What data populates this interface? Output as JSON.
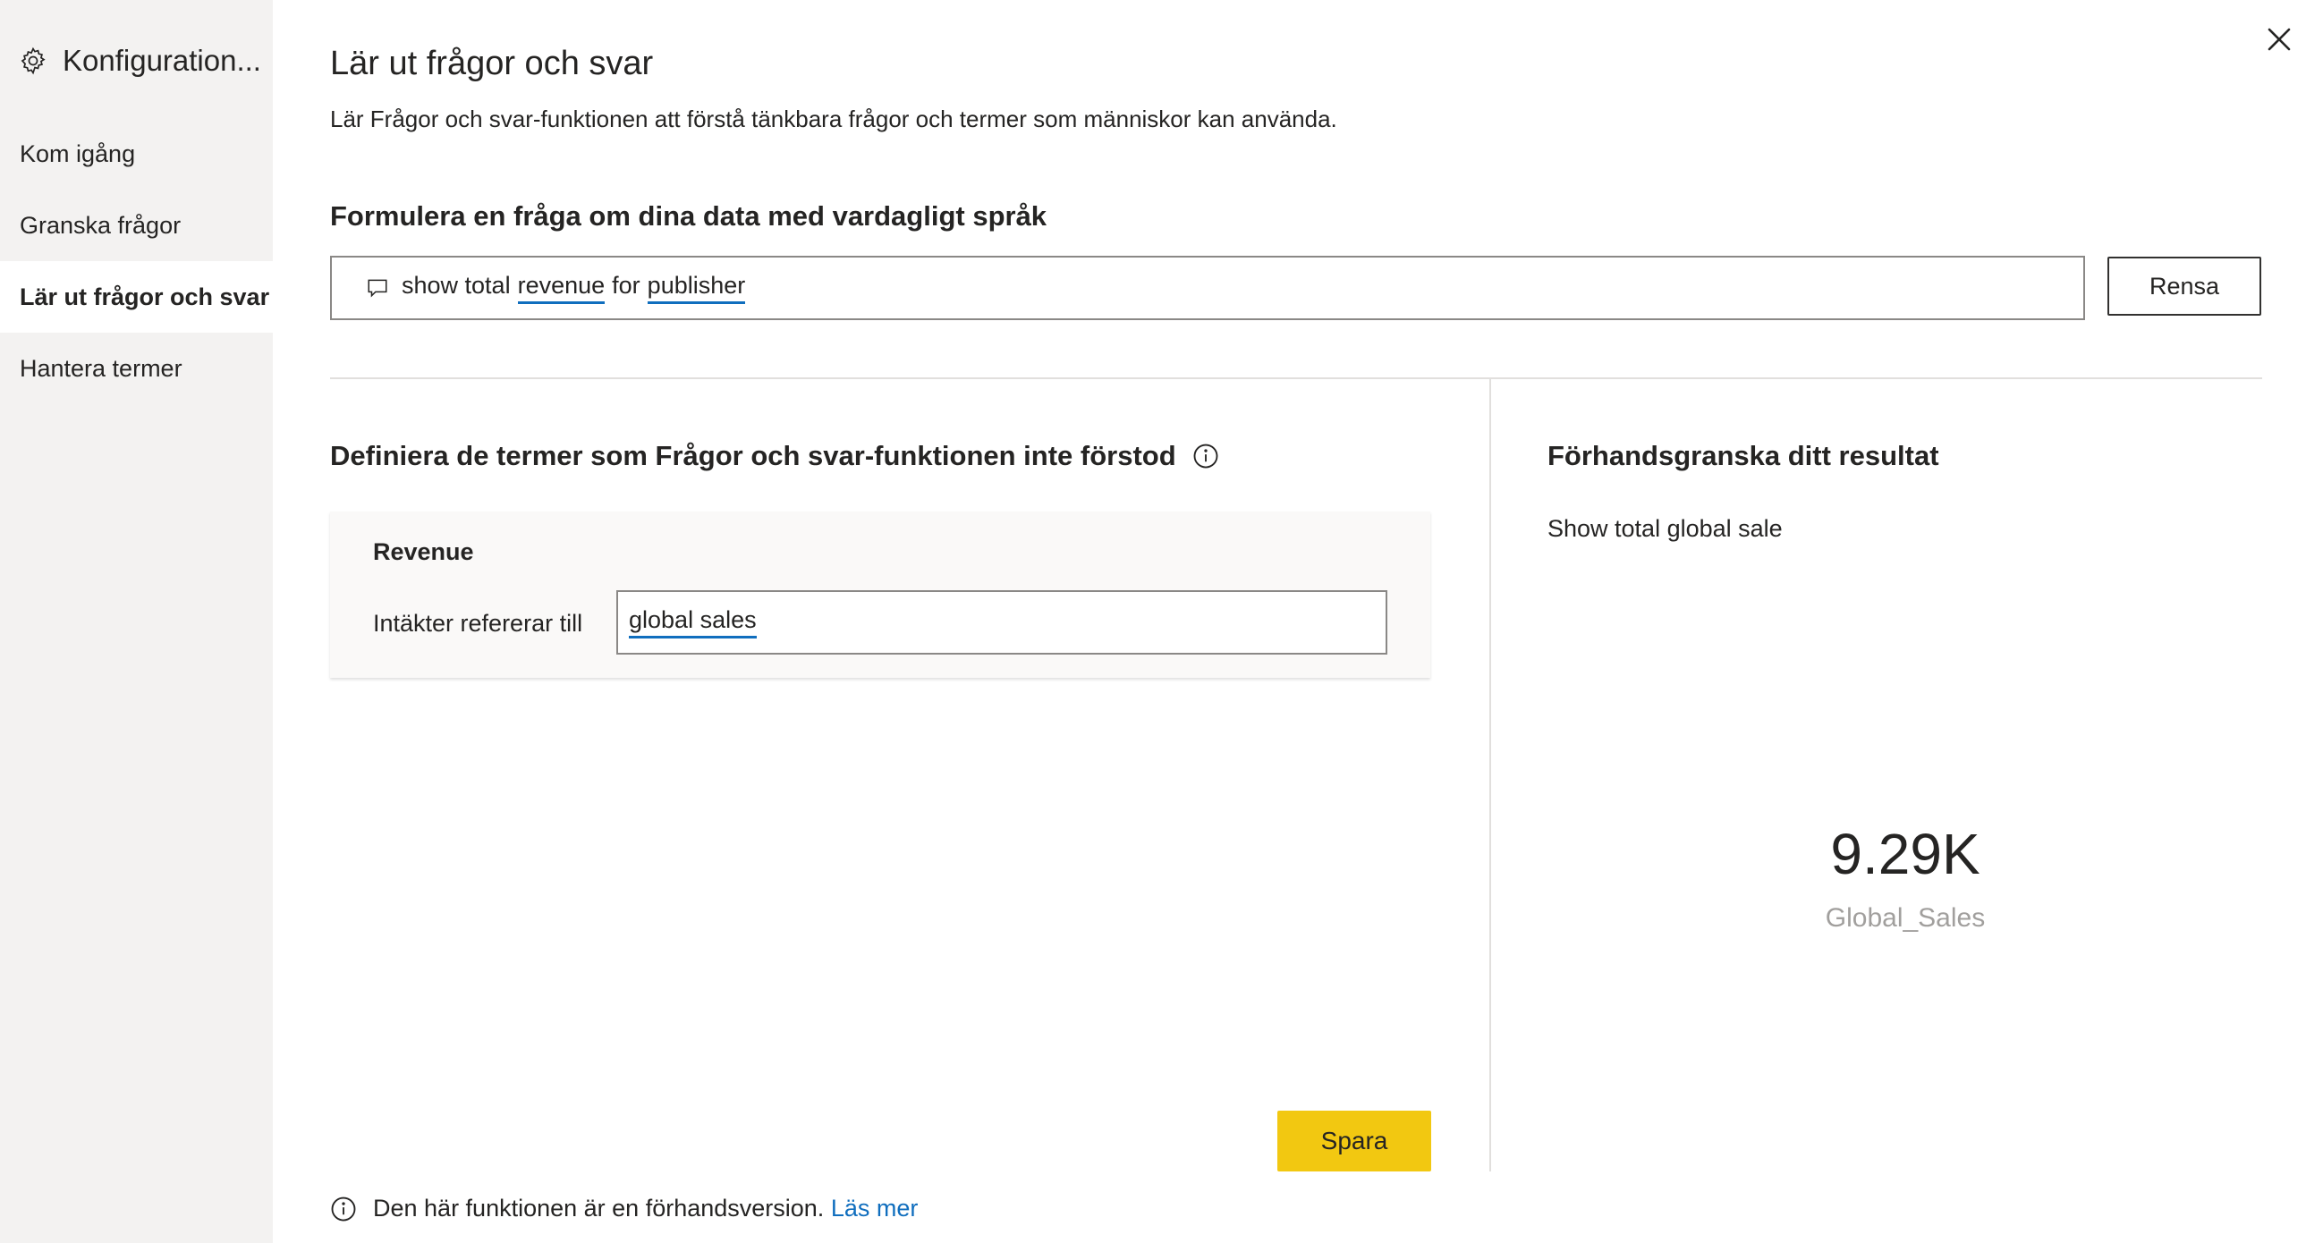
{
  "sidebar": {
    "title": "Konfiguration...",
    "items": [
      {
        "label": "Kom igång"
      },
      {
        "label": "Granska frågor"
      },
      {
        "label": "Lär ut frågor och svar"
      },
      {
        "label": "Hantera termer"
      }
    ]
  },
  "main": {
    "title": "Lär ut frågor och svar",
    "description": "Lär Frågor och svar-funktionen att förstå tänkbara frågor och termer som människor kan använda.",
    "query_heading": "Formulera en fråga om dina data med vardagligt språk",
    "query": {
      "part1": "show total",
      "term1": "revenue",
      "part2": "for",
      "term2": "publisher"
    },
    "clear_label": "Rensa",
    "define_heading": "Definiera de termer som Frågor och svar-funktionen inte förstod",
    "term_card": {
      "term": "Revenue",
      "label": "Intäkter refererar till",
      "value": "global sales"
    },
    "save_label": "Spara"
  },
  "preview": {
    "heading": "Förhandsgranska ditt resultat",
    "query": "Show total global sale",
    "kpi_value": "9.29K",
    "kpi_label": "Global_Sales"
  },
  "footer": {
    "text": "Den här funktionen är en förhandsversion.",
    "link": "Läs mer"
  },
  "colors": {
    "accent_yellow": "#f2c811",
    "link_blue": "#106ebe",
    "sidebar_bg": "#f3f2f1"
  }
}
